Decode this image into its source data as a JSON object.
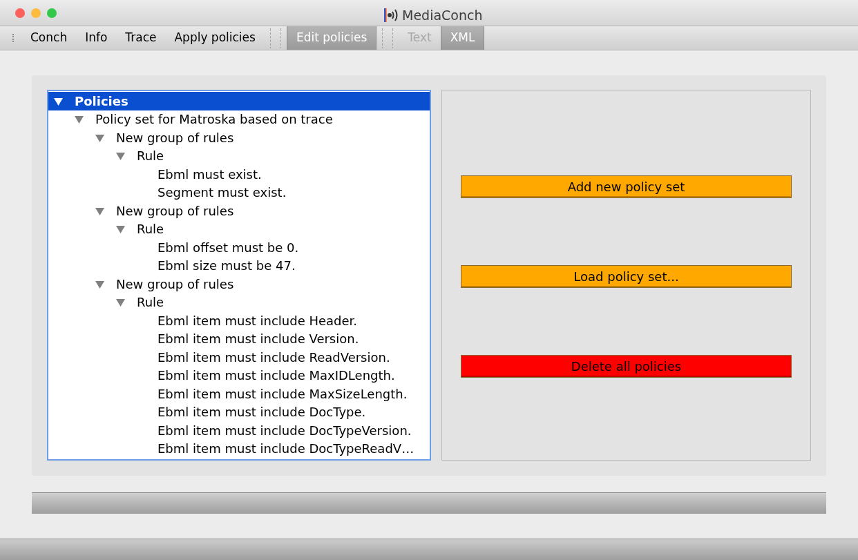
{
  "window": {
    "title": "MediaConch"
  },
  "toolbar": {
    "groups": [
      [
        {
          "label": "Conch",
          "selected": false,
          "disabled": false
        },
        {
          "label": "Info",
          "selected": false,
          "disabled": false
        },
        {
          "label": "Trace",
          "selected": false,
          "disabled": false
        },
        {
          "label": "Apply policies",
          "selected": false,
          "disabled": false
        }
      ],
      [
        {
          "label": "Edit policies",
          "selected": true,
          "disabled": false
        }
      ],
      [
        {
          "label": "Text",
          "selected": false,
          "disabled": true
        },
        {
          "label": "XML",
          "selected": true,
          "disabled": false
        }
      ]
    ]
  },
  "tree": [
    {
      "label": "Policies",
      "selected": true,
      "expanded": true,
      "children": [
        {
          "label": "Policy set for Matroska based on trace",
          "selected": false,
          "expanded": true,
          "children": [
            {
              "label": "New group of rules",
              "selected": false,
              "expanded": true,
              "children": [
                {
                  "label": "Rule",
                  "selected": false,
                  "expanded": true,
                  "children": [
                    {
                      "label": "Ebml must exist.",
                      "selected": false
                    },
                    {
                      "label": "Segment must exist.",
                      "selected": false
                    }
                  ]
                }
              ]
            },
            {
              "label": "New group of rules",
              "selected": false,
              "expanded": true,
              "children": [
                {
                  "label": "Rule",
                  "selected": false,
                  "expanded": true,
                  "children": [
                    {
                      "label": "Ebml offset must be 0.",
                      "selected": false
                    },
                    {
                      "label": "Ebml size must be 47.",
                      "selected": false
                    }
                  ]
                }
              ]
            },
            {
              "label": "New group of rules",
              "selected": false,
              "expanded": true,
              "children": [
                {
                  "label": "Rule",
                  "selected": false,
                  "expanded": true,
                  "children": [
                    {
                      "label": "Ebml item must include Header.",
                      "selected": false
                    },
                    {
                      "label": "Ebml item must include Version.",
                      "selected": false
                    },
                    {
                      "label": "Ebml item must include ReadVersion.",
                      "selected": false
                    },
                    {
                      "label": "Ebml item must include MaxIDLength.",
                      "selected": false
                    },
                    {
                      "label": "Ebml item must include MaxSizeLength.",
                      "selected": false
                    },
                    {
                      "label": "Ebml item must include DocType.",
                      "selected": false
                    },
                    {
                      "label": "Ebml item must include DocTypeVersion.",
                      "selected": false
                    },
                    {
                      "label": "Ebml item must include DocTypeReadV…",
                      "selected": false
                    }
                  ]
                }
              ]
            }
          ]
        }
      ]
    }
  ],
  "actions": [
    {
      "label": "Add new policy set",
      "color": "#ffa800"
    },
    {
      "label": "Load policy set...",
      "color": "#ffa800"
    },
    {
      "label": "Delete all policies",
      "color": "#ff0000"
    }
  ]
}
